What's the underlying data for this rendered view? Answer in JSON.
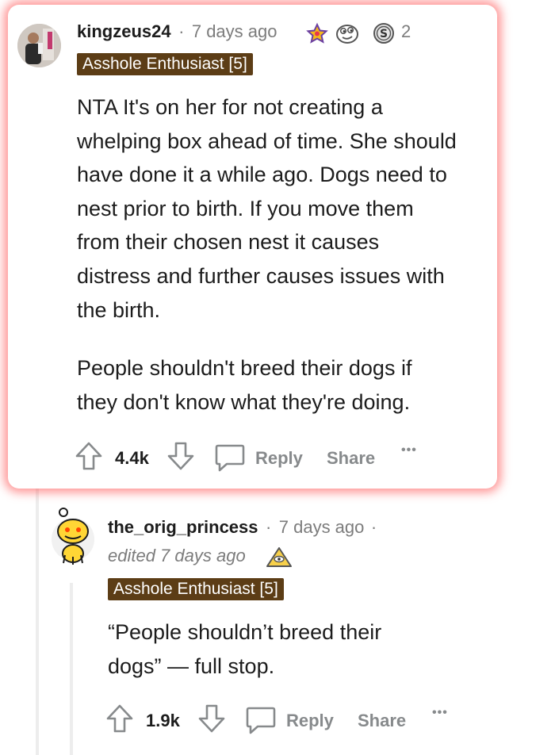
{
  "comments": [
    {
      "username": "kingzeus24",
      "separator": "·",
      "time": "7 days ago",
      "award_count": "2",
      "flair": "Asshole Enthusiast [5]",
      "paragraphs": [
        "NTA It's on her for not creating a whelping box ahead of time. She should have done it a while ago. Dogs need to nest prior to birth. If you move them from their chosen nest it causes distress and further causes issues with the birth.",
        "People shouldn't breed their dogs if they don't know what they're doing."
      ],
      "score": "4.4k",
      "reply_label": "Reply",
      "share_label": "Share",
      "more_label": "•••"
    },
    {
      "username": "the_orig_princess",
      "separator": "·",
      "time": "7 days ago",
      "separator2": "·",
      "edited": "edited 7 days ago",
      "flair": "Asshole Enthusiast [5]",
      "paragraphs": [
        "“People shouldn’t breed their dogs” — full stop."
      ],
      "score": "1.9k",
      "reply_label": "Reply",
      "share_label": "Share",
      "more_label": "•••"
    }
  ],
  "icons": {
    "upvote": "arrow-up-icon",
    "downvote": "arrow-down-icon",
    "reply": "speech-bubble-icon",
    "award1": "star-award-icon",
    "award2": "eyes-emoji-award-icon",
    "award3": "silver-coin-award-icon",
    "award4": "pyramid-award-icon"
  },
  "colors": {
    "flair_bg": "#5c3d16",
    "highlight": "#ff3c3c",
    "action_gray": "#878a8c"
  }
}
